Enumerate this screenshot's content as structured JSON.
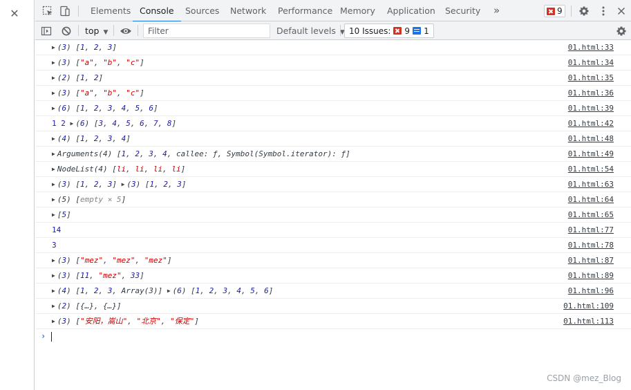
{
  "tabs": [
    "Elements",
    "Console",
    "Sources",
    "Network",
    "Performance",
    "Memory",
    "Application",
    "Security"
  ],
  "more_tabs": "»",
  "error_count": "9",
  "toolbar": {
    "context": "top",
    "filter_placeholder": "Filter",
    "levels": "Default levels",
    "issues_label": "10 Issues:",
    "issues_errors": "9",
    "issues_messages": "1"
  },
  "console_rows": [
    {
      "text": "(3) [1, 2, 3]",
      "src": "01.html:33"
    },
    {
      "text": "(3) [\"a\", \"b\", \"c\"]",
      "src": "01.html:34"
    },
    {
      "text": "(2) [1, 2]",
      "src": "01.html:35"
    },
    {
      "text": "(3) [\"a\", \"b\", \"c\"]",
      "src": "01.html:36"
    },
    {
      "text": "(6) [1, 2, 3, 4, 5, 6]",
      "src": "01.html:39"
    },
    {
      "text": "1 2 (6) [3, 4, 5, 6, 7, 8]",
      "src": "01.html:42"
    },
    {
      "text": "(4) [1, 2, 3, 4]",
      "src": "01.html:48"
    },
    {
      "text": "Arguments(4) [1, 2, 3, 4, callee: ƒ, Symbol(Symbol.iterator): ƒ]",
      "src": "01.html:49"
    },
    {
      "text": "NodeList(4) [li, li, li, li]",
      "src": "01.html:54"
    },
    {
      "text": "(3) [1, 2, 3] (3) [1, 2, 3]",
      "src": "01.html:63"
    },
    {
      "text": "(5) [empty × 5]",
      "src": "01.html:64"
    },
    {
      "text": "[5]",
      "src": "01.html:65"
    },
    {
      "text": "14",
      "src": "01.html:77"
    },
    {
      "text": "3",
      "src": "01.html:78"
    },
    {
      "text": "(3) [\"mez\", \"mez\", \"mez\"]",
      "src": "01.html:87"
    },
    {
      "text": "(3) [11, \"mez\", 33]",
      "src": "01.html:89"
    },
    {
      "text": "(4) [1, 2, 3, Array(3)] (6) [1, 2, 3, 4, 5, 6]",
      "src": "01.html:96"
    },
    {
      "text": "(2) [{…}, {…}]",
      "src": "01.html:109"
    },
    {
      "text": "(3) [\"安阳，嵩山\", \"北京\", \"保定\"]",
      "src": "01.html:113"
    }
  ],
  "watermark": "CSDN @mez_Blog"
}
